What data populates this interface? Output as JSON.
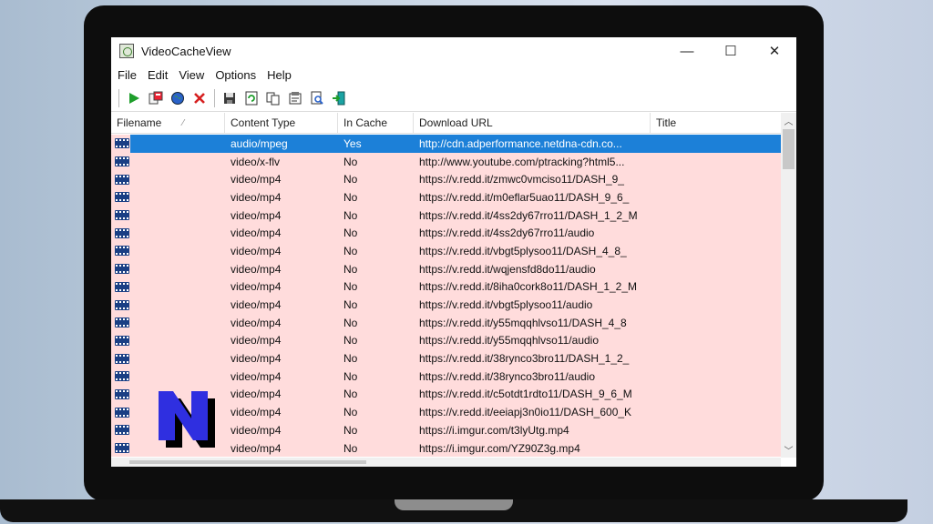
{
  "window": {
    "title": "VideoCacheView"
  },
  "window_controls": [
    "—",
    "☐",
    "✕"
  ],
  "menu": [
    "File",
    "Edit",
    "View",
    "Options",
    "Help"
  ],
  "toolbar_icons": [
    "play-icon",
    "copy-files-icon",
    "globe-icon",
    "delete-icon",
    "save-icon",
    "refresh-icon",
    "copy-icon",
    "properties-icon",
    "find-icon",
    "exit-icon"
  ],
  "columns": {
    "filename": "Filename",
    "content_type": "Content Type",
    "in_cache": "In Cache",
    "download_url": "Download URL",
    "title": "Title"
  },
  "rows": [
    {
      "filename": "",
      "content_type": "audio/mpeg",
      "in_cache": "Yes",
      "download_url": "http://cdn.adperformance.netdna-cdn.co...",
      "title": "",
      "selected": true
    },
    {
      "filename": "",
      "content_type": "video/x-flv",
      "in_cache": "No",
      "download_url": "http://www.youtube.com/ptracking?html5...",
      "title": ""
    },
    {
      "filename": "",
      "content_type": "video/mp4",
      "in_cache": "No",
      "download_url": "https://v.redd.it/zmwc0vmciso11/DASH_9_",
      "title": ""
    },
    {
      "filename": "",
      "content_type": "video/mp4",
      "in_cache": "No",
      "download_url": "https://v.redd.it/m0eflar5uao11/DASH_9_6_",
      "title": ""
    },
    {
      "filename": "",
      "content_type": "video/mp4",
      "in_cache": "No",
      "download_url": "https://v.redd.it/4ss2dy67rro11/DASH_1_2_M",
      "title": ""
    },
    {
      "filename": "",
      "content_type": "video/mp4",
      "in_cache": "No",
      "download_url": "https://v.redd.it/4ss2dy67rro11/audio",
      "title": ""
    },
    {
      "filename": "",
      "content_type": "video/mp4",
      "in_cache": "No",
      "download_url": "https://v.redd.it/vbgt5plysoo11/DASH_4_8_",
      "title": ""
    },
    {
      "filename": "",
      "content_type": "video/mp4",
      "in_cache": "No",
      "download_url": "https://v.redd.it/wqjensfd8do11/audio",
      "title": ""
    },
    {
      "filename": "",
      "content_type": "video/mp4",
      "in_cache": "No",
      "download_url": "https://v.redd.it/8iha0cork8o11/DASH_1_2_M",
      "title": ""
    },
    {
      "filename": "",
      "content_type": "video/mp4",
      "in_cache": "No",
      "download_url": "https://v.redd.it/vbgt5plysoo11/audio",
      "title": ""
    },
    {
      "filename": "",
      "content_type": "video/mp4",
      "in_cache": "No",
      "download_url": "https://v.redd.it/y55mqqhlvso11/DASH_4_8",
      "title": ""
    },
    {
      "filename": "",
      "content_type": "video/mp4",
      "in_cache": "No",
      "download_url": "https://v.redd.it/y55mqqhlvso11/audio",
      "title": ""
    },
    {
      "filename": "",
      "content_type": "video/mp4",
      "in_cache": "No",
      "download_url": "https://v.redd.it/38rynco3bro11/DASH_1_2_",
      "title": ""
    },
    {
      "filename": "",
      "content_type": "video/mp4",
      "in_cache": "No",
      "download_url": "https://v.redd.it/38rynco3bro11/audio",
      "title": ""
    },
    {
      "filename": "",
      "content_type": "video/mp4",
      "in_cache": "No",
      "download_url": "https://v.redd.it/c5otdt1rdto11/DASH_9_6_M",
      "title": ""
    },
    {
      "filename": "",
      "content_type": "video/mp4",
      "in_cache": "No",
      "download_url": "https://v.redd.it/eeiapj3n0io11/DASH_600_K",
      "title": ""
    },
    {
      "filename": "",
      "content_type": "video/mp4",
      "in_cache": "No",
      "download_url": "https://i.imgur.com/t3lyUtg.mp4",
      "title": ""
    },
    {
      "filename": "",
      "content_type": "video/mp4",
      "in_cache": "No",
      "download_url": "https://i.imgur.com/YZ90Z3g.mp4",
      "title": ""
    }
  ],
  "watermark": {
    "letter": "N",
    "color": "#2f2fe0"
  },
  "colors": {
    "row_background": "#ffdcdc",
    "selection": "#1c80d8",
    "file_icon": "#1a3f84"
  }
}
